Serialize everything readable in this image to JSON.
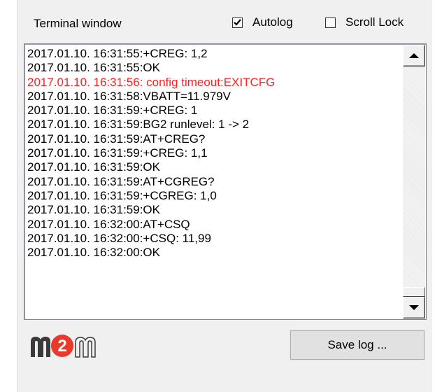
{
  "panel": {
    "title": "Terminal window",
    "autolog": {
      "label": "Autolog",
      "checked": true
    },
    "scroll_lock": {
      "label": "Scroll Lock",
      "checked": false
    }
  },
  "terminal": {
    "lines": [
      {
        "text": "2017.01.10. 16:31:55:+CREG: 1,2",
        "type": "normal"
      },
      {
        "text": "2017.01.10. 16:31:55:OK",
        "type": "normal"
      },
      {
        "text": "2017.01.10. 16:31:56: config timeout:EXITCFG",
        "type": "error"
      },
      {
        "text": "2017.01.10. 16:31:58:VBATT=11.979V",
        "type": "normal"
      },
      {
        "text": "2017.01.10. 16:31:59:+CREG: 1",
        "type": "normal"
      },
      {
        "text": "2017.01.10. 16:31:59:BG2 runlevel: 1 -> 2",
        "type": "normal"
      },
      {
        "text": "2017.01.10. 16:31:59:AT+CREG?",
        "type": "normal"
      },
      {
        "text": "2017.01.10. 16:31:59:+CREG: 1,1",
        "type": "normal"
      },
      {
        "text": "2017.01.10. 16:31:59:OK",
        "type": "normal"
      },
      {
        "text": "2017.01.10. 16:31:59:AT+CGREG?",
        "type": "normal"
      },
      {
        "text": "2017.01.10. 16:31:59:+CGREG: 1,0",
        "type": "normal"
      },
      {
        "text": "2017.01.10. 16:31:59:OK",
        "type": "normal"
      },
      {
        "text": "2017.01.10. 16:32:00:AT+CSQ",
        "type": "normal"
      },
      {
        "text": "2017.01.10. 16:32:00:+CSQ: 11,99",
        "type": "normal"
      },
      {
        "text": "2017.01.10. 16:32:00:OK",
        "type": "normal"
      }
    ]
  },
  "logo": {
    "text": "m2m",
    "accent_color": "#e8392c",
    "dark_color": "#3a3a3a"
  },
  "buttons": {
    "save_log": "Save log ..."
  },
  "colors": {
    "error_text": "#ff2020",
    "normal_text": "#000000"
  }
}
